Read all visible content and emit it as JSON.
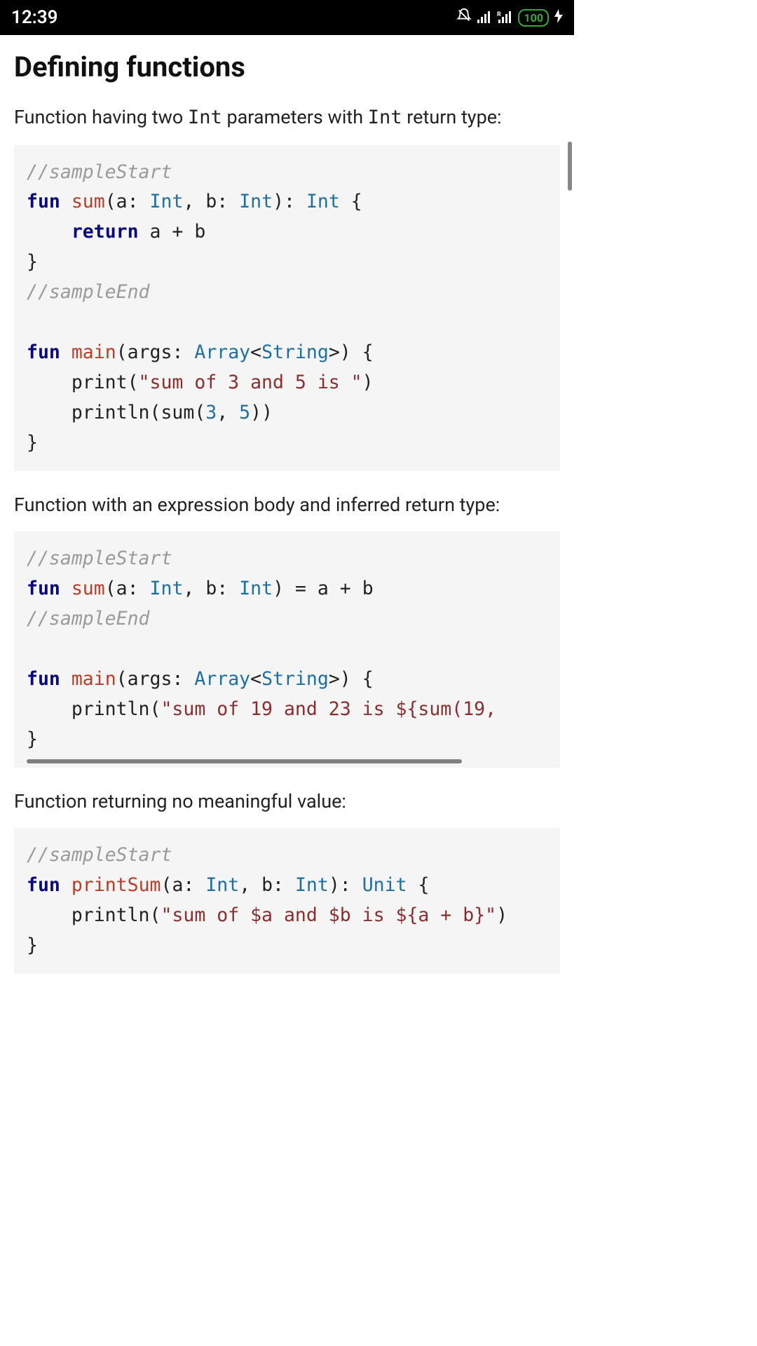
{
  "status": {
    "time": "12:39",
    "battery": "100"
  },
  "page": {
    "heading": "Defining functions",
    "p1_a": "Function having two ",
    "p1_code1": "Int",
    "p1_b": " parameters with ",
    "p1_code2": "Int",
    "p1_c": " return type:",
    "p2": "Function with an expression body and inferred return type:",
    "p3": "Function returning no meaningful value:"
  },
  "code": {
    "block1": {
      "cmt1": "//sampleStart",
      "l1_kw": "fun",
      "l1_fn": "sum",
      "l1_a": "(a: ",
      "l1_t1": "Int",
      "l1_b": ", b: ",
      "l1_t2": "Int",
      "l1_c": "): ",
      "l1_t3": "Int",
      "l1_d": " {",
      "l2_a": "    ",
      "l2_kw": "return",
      "l2_b": " a + b",
      "l3": "}",
      "cmt2": "//sampleEnd",
      "blank": "",
      "l4_kw": "fun",
      "l4_fn": "main",
      "l4_a": "(args: ",
      "l4_t1": "Array",
      "l4_b": "<",
      "l4_t2": "String",
      "l4_c": ">) {",
      "l5_a": "    print(",
      "l5_str": "\"sum of 3 and 5 is \"",
      "l5_b": ")",
      "l6_a": "    println(sum(",
      "l6_n1": "3",
      "l6_b": ", ",
      "l6_n2": "5",
      "l6_c": "))",
      "l7": "}"
    },
    "block2": {
      "cmt1": "//sampleStart",
      "l1_kw": "fun",
      "l1_fn": "sum",
      "l1_a": "(a: ",
      "l1_t1": "Int",
      "l1_b": ", b: ",
      "l1_t2": "Int",
      "l1_c": ") = a + b",
      "cmt2": "//sampleEnd",
      "blank": "",
      "l2_kw": "fun",
      "l2_fn": "main",
      "l2_a": "(args: ",
      "l2_t1": "Array",
      "l2_b": "<",
      "l2_t2": "String",
      "l2_c": ">) {",
      "l3_a": "    println(",
      "l3_str": "\"sum of 19 and 23 is ${sum(19,",
      "l4": "}"
    },
    "block3": {
      "cmt1": "//sampleStart",
      "l1_kw": "fun",
      "l1_fn": "printSum",
      "l1_a": "(a: ",
      "l1_t1": "Int",
      "l1_b": ", b: ",
      "l1_t2": "Int",
      "l1_c": "): ",
      "l1_t3": "Unit",
      "l1_d": " {",
      "l2_a": "    println(",
      "l2_str": "\"sum of $a and $b is ${a + b}\"",
      "l2_b": ")",
      "l3": "}"
    }
  }
}
